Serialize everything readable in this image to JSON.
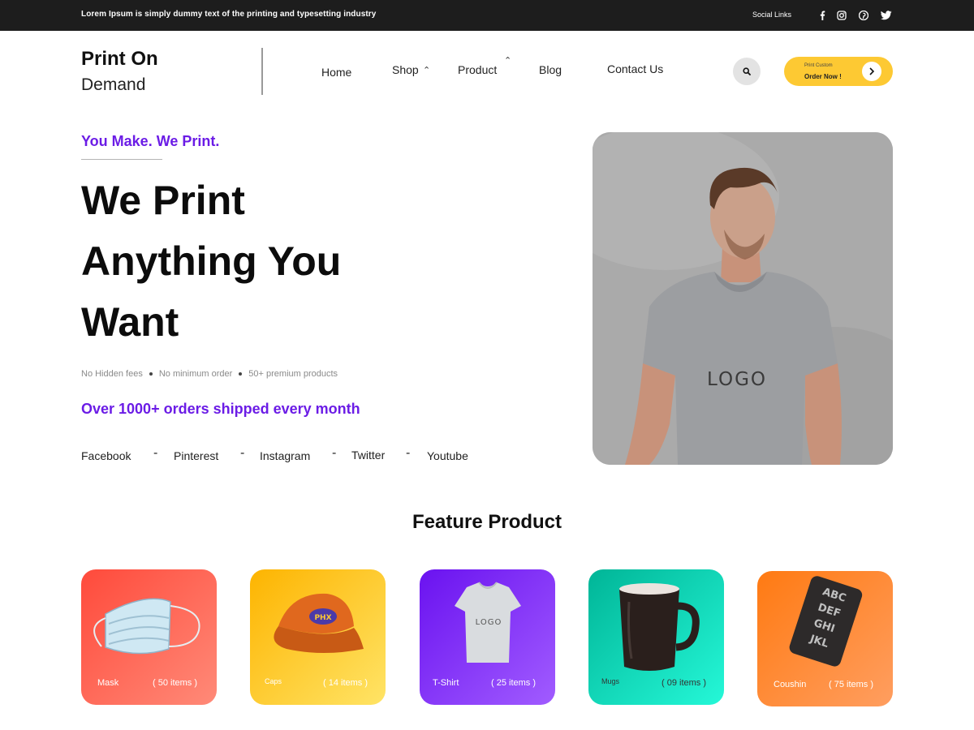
{
  "topbar": {
    "tagline": "Lorem Ipsum is simply dummy text of the printing and typesetting industry",
    "social_label": "Social Links",
    "social_icons": [
      "facebook-icon",
      "instagram-icon",
      "pinterest-icon",
      "twitter-icon"
    ]
  },
  "header": {
    "logo_line1": "Print On",
    "logo_line2": "Demand",
    "nav": [
      {
        "label": "Home"
      },
      {
        "label": "Shop"
      },
      {
        "label": "Product"
      },
      {
        "label": "Blog"
      },
      {
        "label": "Contact Us"
      }
    ],
    "search_icon": "search-icon",
    "cta": {
      "small": "Print Custom",
      "main": "Order Now !"
    }
  },
  "hero": {
    "kicker": "You Make. We Print.",
    "title_lines": [
      "We Print",
      "Anything You",
      "Want"
    ],
    "features": [
      "No Hidden fees",
      "No minimum order",
      "50+ premium products"
    ],
    "orders": "Over 1000+ orders shipped every month",
    "social_links": [
      "Facebook",
      "Pinterest",
      "Instagram",
      "Twitter",
      "Youtube"
    ],
    "separator": "-",
    "image_logo_text": "LOGO"
  },
  "features_section": {
    "title": "Feature Product",
    "products": [
      {
        "name": "Mask",
        "count": "( 50 items )",
        "color_from": "#ff4a3b",
        "color_to": "#ff8a78"
      },
      {
        "name": "Caps",
        "count": "( 14 items )",
        "color_from": "#fdb400",
        "color_to": "#ffe466"
      },
      {
        "name": "T-Shirt",
        "count": "( 25 items )",
        "color_from": "#6a12f0",
        "color_to": "#a15cff",
        "logo": "LOGO"
      },
      {
        "name": "Mugs",
        "count": "( 09 items )",
        "color_from": "#00b597",
        "color_to": "#25f8d8"
      },
      {
        "name": "Coushin",
        "count": "( 75 items )",
        "color_from": "#ff7a12",
        "color_to": "#ff9e60"
      }
    ]
  },
  "colors": {
    "accent_purple": "#6b1ce6",
    "cta_yellow": "#fdc933",
    "topbar_bg": "#1d1d1d"
  }
}
